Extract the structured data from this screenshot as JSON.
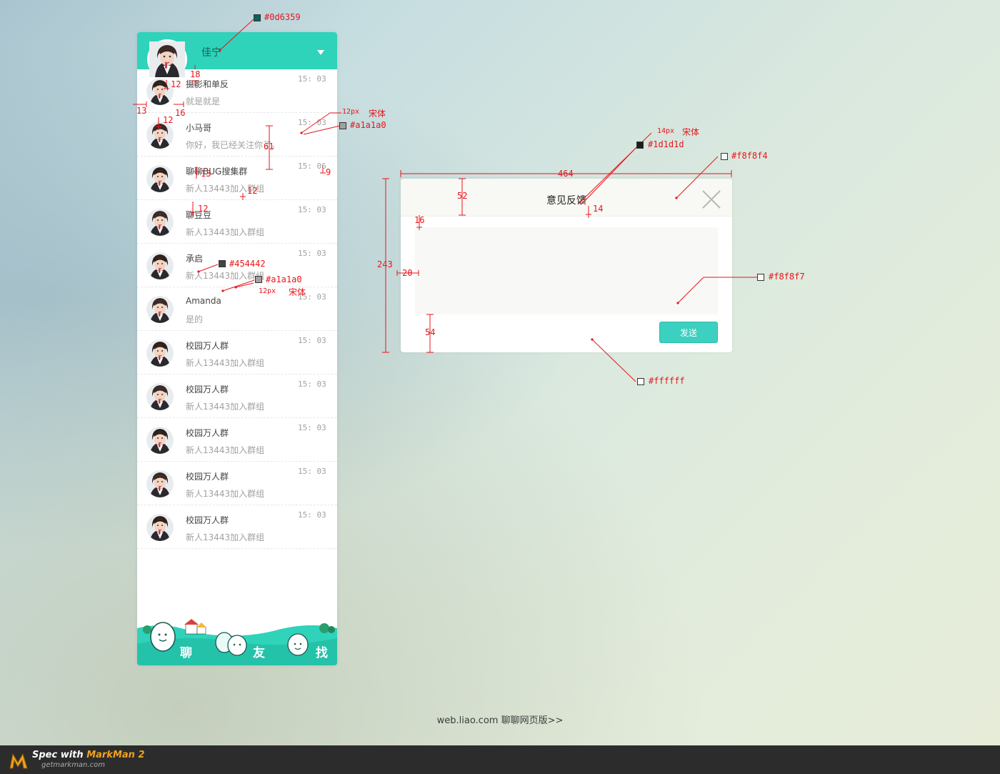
{
  "panel": {
    "user_name": "佳宁",
    "chats": [
      {
        "name": "摄影和单反",
        "preview": "就是就是",
        "time": "15: 03"
      },
      {
        "name": "小马哥",
        "preview": "你好，我已经关注你了。",
        "time": "15: 03"
      },
      {
        "name": "聊聊BUG搜集群",
        "preview": "新人13443加入群组",
        "time": "15: 06"
      },
      {
        "name": "聊豆豆",
        "preview": "新人13443加入群组",
        "time": "15: 03"
      },
      {
        "name": "承启",
        "preview": "新人13443加入群组",
        "time": "15: 03"
      },
      {
        "name": "Amanda",
        "preview": "是的",
        "time": "15: 03"
      },
      {
        "name": "校园万人群",
        "preview": "新人13443加入群组",
        "time": "15: 03"
      },
      {
        "name": "校园万人群",
        "preview": "新人13443加入群组",
        "time": "15: 03"
      },
      {
        "name": "校园万人群",
        "preview": "新人13443加入群组",
        "time": "15: 03"
      },
      {
        "name": "校园万人群",
        "preview": "新人13443加入群组",
        "time": "15: 03"
      },
      {
        "name": "校园万人群",
        "preview": "新人13443加入群组",
        "time": "15: 03"
      }
    ],
    "footer_tabs": {
      "chat": "聊",
      "friends": "友",
      "find": "找"
    }
  },
  "dialog": {
    "title": "意见反馈",
    "send_label": "发送",
    "textarea_value": ""
  },
  "annotations": {
    "c_0d6359": "#0d6359",
    "c_a1a1a0_1": "#a1a1a0",
    "c_a1a1a0_2": "#a1a1a0",
    "c_454442": "#454442",
    "c_1d1d1d": "#1d1d1d",
    "c_f8f8f4": "#f8f8f4",
    "c_f8f8f7": "#f8f8f7",
    "c_ffffff": "#ffffff",
    "font_12_a": "12px",
    "font_12_b": "12px",
    "font_14": "14px",
    "font_song_a": "宋体",
    "font_song_b": "宋体",
    "font_song_c": "宋体",
    "m18": "18",
    "m12a": "12",
    "m13a": "13",
    "m16a": "16",
    "m12b": "12",
    "m61": "61",
    "m13b": "13",
    "m9": "9",
    "m12c": "12",
    "m12d": "12",
    "m464": "464",
    "m52": "52",
    "m14": "14",
    "m16b": "16",
    "m243": "243",
    "m20": "20",
    "m54": "54"
  },
  "footer": {
    "link": "web.liao.com 聊聊网页版>>"
  },
  "markman": {
    "spec": "Spec with ",
    "brand": "MarkMan 2",
    "url": "getmarkman.com"
  },
  "colors": {
    "header_teal": "#2fd3ba",
    "name_text": "#454442",
    "preview_text": "#a1a1a0",
    "title_text": "#1d1d1d",
    "dialog_header_bg": "#f8f8f4",
    "textarea_bg": "#f8f8f7",
    "send_button": "#3cd0c0"
  }
}
